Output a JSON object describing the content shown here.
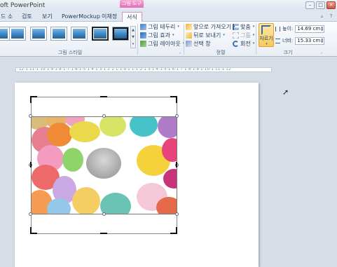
{
  "window": {
    "title": "oft PowerPoint",
    "context_group": "그림 도구",
    "min_icon": "minimize-icon",
    "max_icon": "maximize-icon",
    "close_icon": "close-icon"
  },
  "tabs": [
    {
      "label": "드 소",
      "active": false
    },
    {
      "label": "검토",
      "active": false
    },
    {
      "label": "보기",
      "active": false
    },
    {
      "label": "PowerMockup",
      "active": false
    },
    {
      "label": "이재정",
      "active": false
    },
    {
      "label": "서식",
      "active": true
    }
  ],
  "ribbon": {
    "picture_styles": {
      "label": "그림 스타일",
      "border": "그림 테두리",
      "effects": "그림 효과",
      "layout": "그림 레이아웃"
    },
    "arrange": {
      "label": "정렬",
      "bring_forward": "앞으로 가져오기",
      "send_backward": "뒤로 보내기",
      "selection_pane": "선택 창",
      "align": "맞춤",
      "group": "그룹",
      "rotate": "회전"
    },
    "size": {
      "label": "크기",
      "crop": "자르기",
      "height_label": "높이:",
      "height_value": "14.69 cm",
      "width_label": "너비:",
      "width_value": "15.33 cm"
    }
  },
  "ruler": {
    "text": "·12·1·11·1·10·1·9·1·8·1·7·1·6·1·5·1·4·1·3·1·2·1·1·1·0·1·1·1·2·1·3·1·4·1·5·1·6·1·7·1·8·1·9·1·10·1·11·1·12·"
  },
  "colors": {
    "accent_pink": "#e56bb7",
    "crop_button": "#f8c95c"
  }
}
